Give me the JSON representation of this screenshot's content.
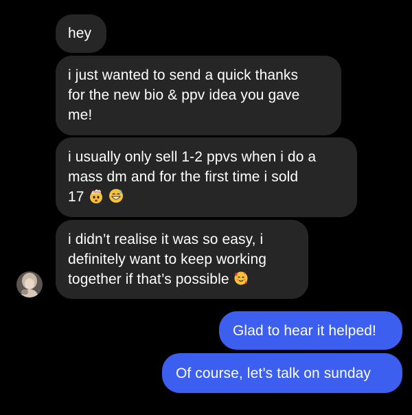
{
  "conversation": {
    "incoming": [
      {
        "lines": [
          "hey"
        ]
      },
      {
        "lines": [
          "i just wanted to send a quick thanks",
          "for the new bio & ppv idea you gave",
          "me!"
        ]
      },
      {
        "lines": [
          "i usually only sell 1-2 ppvs when i do a",
          "mass dm and for the first time i sold",
          "17"
        ],
        "emojis": [
          "exploding-head-emoji",
          "grinning-sweat-emoji"
        ]
      },
      {
        "lines": [
          "i didn’t realise it was so easy, i",
          "definitely want to keep working",
          "together if that’s possible"
        ],
        "emojis": [
          "smiling-hearts-emoji"
        ]
      }
    ],
    "outgoing": [
      {
        "text": "Glad to hear it helped!"
      },
      {
        "text": "Of course, let’s talk on sunday"
      }
    ]
  },
  "contact": {
    "avatar_icon": "contact-avatar"
  },
  "colors": {
    "background": "#000000",
    "incoming_bubble": "#262626",
    "outgoing_bubble": "#3d5ff0",
    "text": "#ffffff"
  }
}
